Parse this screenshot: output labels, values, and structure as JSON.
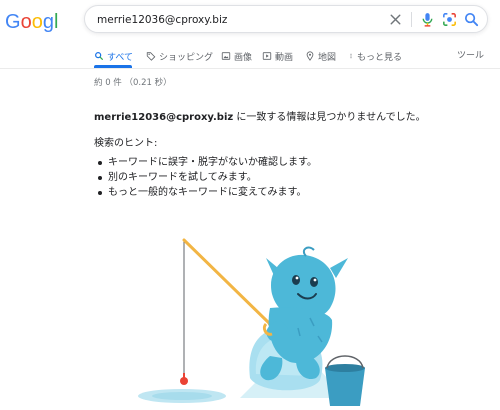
{
  "logo": {
    "text": "Google",
    "colors": [
      "#4285F4",
      "#EA4335",
      "#FBBC05",
      "#4285F4",
      "#34A853",
      "#EA4335"
    ]
  },
  "search": {
    "value": "merrie12036@cproxy.biz",
    "clear_icon": "close-icon",
    "mic_icon": "microphone-icon",
    "lens_icon": "camera-lens-icon",
    "search_icon": "magnifier-icon"
  },
  "tabs": [
    {
      "label": "すべて",
      "icon": "search-icon",
      "active": true
    },
    {
      "label": "ショッピング",
      "icon": "tag-icon"
    },
    {
      "label": "画像",
      "icon": "image-icon"
    },
    {
      "label": "動画",
      "icon": "play-icon"
    },
    {
      "label": "地図",
      "icon": "map-pin-icon"
    },
    {
      "label": "もっと見る",
      "icon": "more-vertical-icon"
    }
  ],
  "tools_label": "ツール",
  "result_stats": "約 0 件 （0.21 秒）",
  "no_results": {
    "query": "merrie12036@cproxy.biz",
    "message": " に一致する情報は見つかりませんでした。"
  },
  "hints": {
    "title": "検索のヒント:",
    "items": [
      "キーワードに誤字・脱字がないか確認します。",
      "別のキーワードを試してみます。",
      "もっと一般的なキーワードに変えてみます。"
    ]
  },
  "colors": {
    "accent": "#1a73e8",
    "yeti": "#4db8d8",
    "rod": "#f2b544",
    "bobber": "#ea4335",
    "bucket": "#3b9dc2"
  }
}
